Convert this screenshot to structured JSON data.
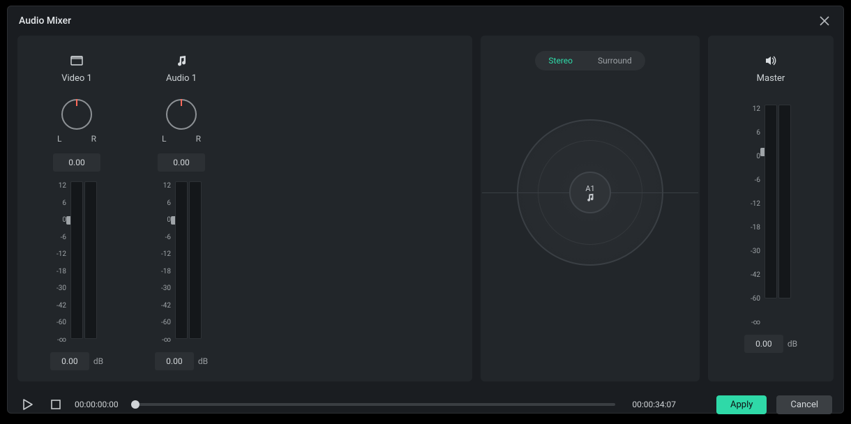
{
  "title": "Audio Mixer",
  "channels": [
    {
      "icon": "video",
      "label": "Video  1",
      "L": "L",
      "R": "R",
      "pan": "0.00",
      "gain": "0.00",
      "unit": "dB"
    },
    {
      "icon": "audio",
      "label": "Audio  1",
      "L": "L",
      "R": "R",
      "pan": "0.00",
      "gain": "0.00",
      "unit": "dB"
    }
  ],
  "scale_labels": [
    "12",
    "6",
    "0",
    "-6",
    "-12",
    "-18",
    "-30",
    "-42",
    "-60",
    "-∞"
  ],
  "surround": {
    "stereo_label": "Stereo",
    "surround_label": "Surround",
    "center_label": "A1"
  },
  "master": {
    "label": "Master",
    "gain": "0.00",
    "unit": "dB"
  },
  "master_scale": [
    "12",
    "6",
    "0",
    "-6",
    "-12",
    "-18",
    "-30",
    "-42",
    "-60",
    "-∞"
  ],
  "transport": {
    "current": "00:00:00:00",
    "total": "00:00:34:07"
  },
  "buttons": {
    "apply": "Apply",
    "cancel": "Cancel"
  }
}
